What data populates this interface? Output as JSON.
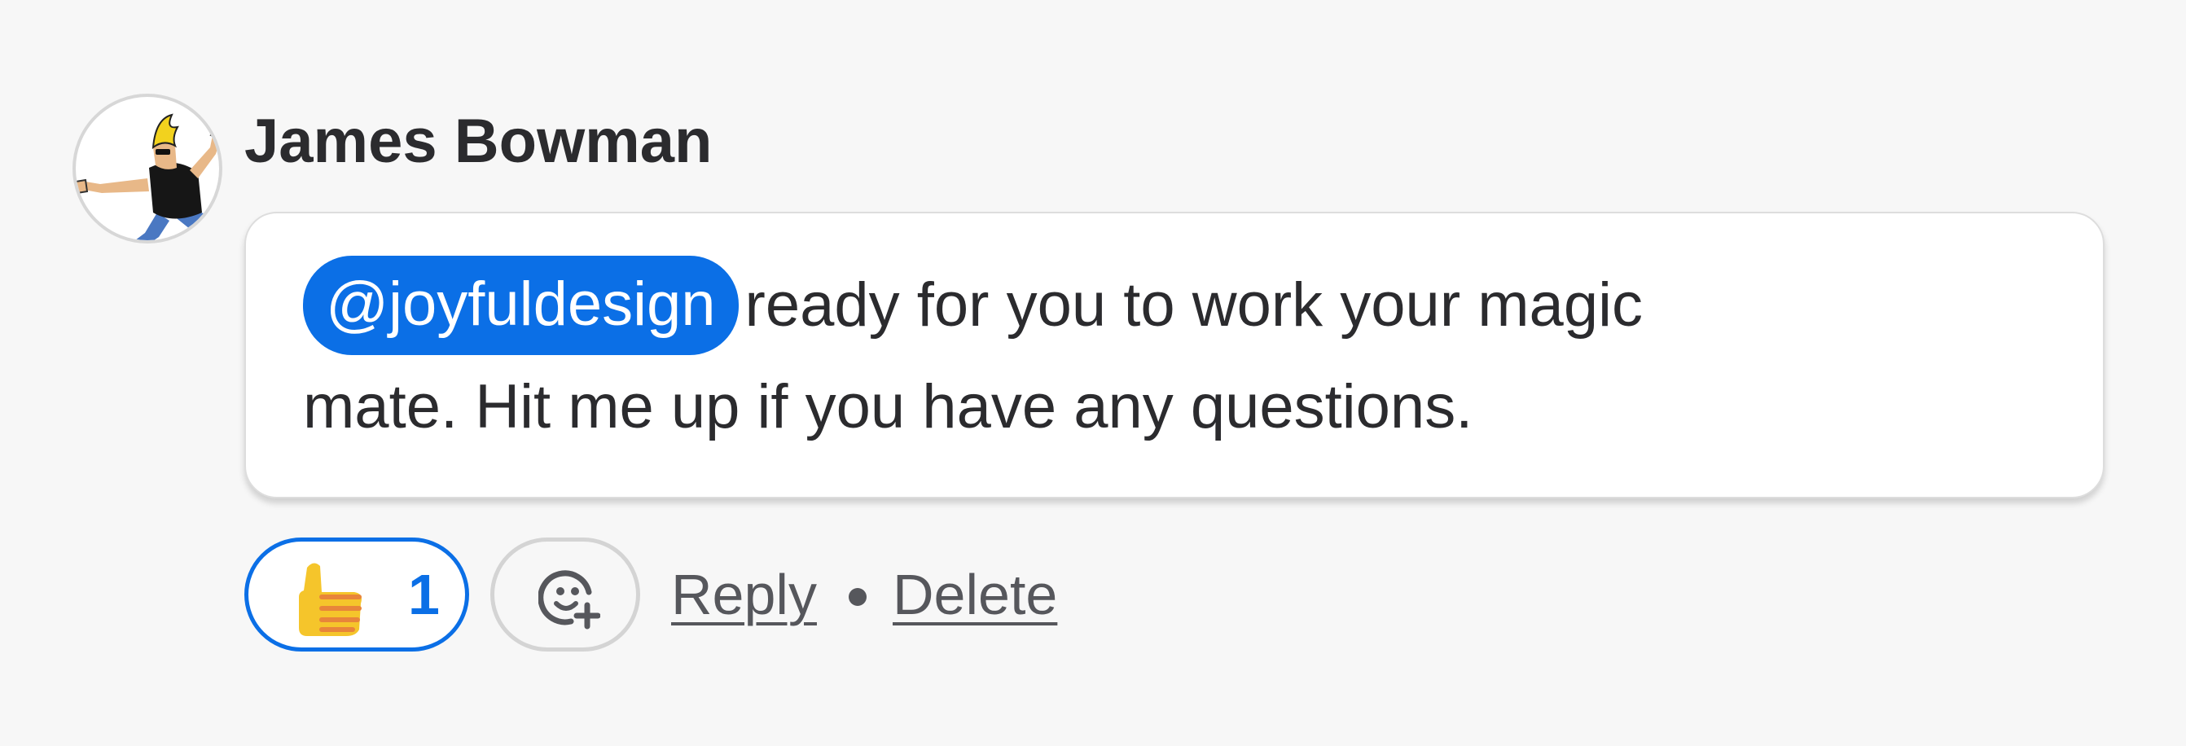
{
  "comment": {
    "author": "James Bowman",
    "mention": "@joyfuldesign",
    "message_line1": "ready for you to work your magic",
    "message_line2": "mate.  Hit me up if you have any questions.",
    "reaction": {
      "icon": "thumbs-up-icon",
      "count": "1"
    },
    "add_reaction_icon": "add-emoji-icon",
    "actions": {
      "reply": "Reply",
      "delete": "Delete"
    }
  },
  "colors": {
    "background": "#f7f7f7",
    "accent": "#0b6fe6",
    "text": "#2b2b2e",
    "muted_text": "#56575c"
  }
}
